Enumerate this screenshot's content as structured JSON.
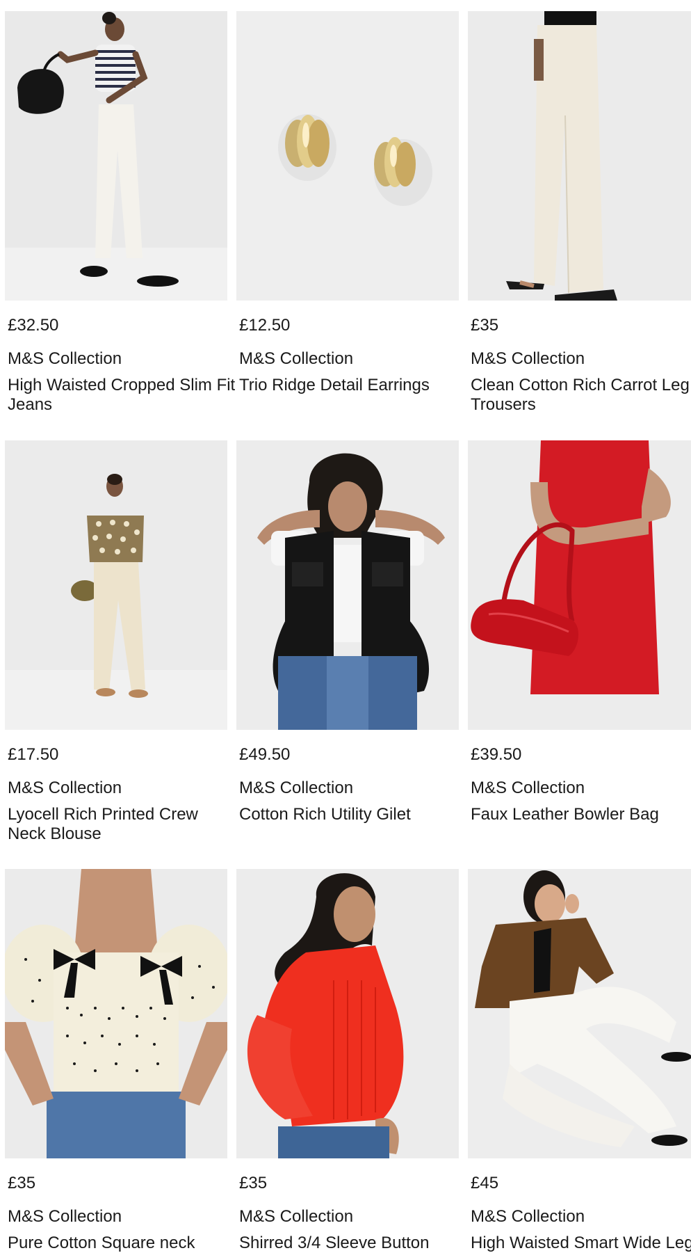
{
  "products": [
    {
      "price": "£32.50",
      "brand": "M&S Collection",
      "title": "High Waisted Cropped Slim Fit Jeans",
      "image": "model-white-cropped-jeans-striped-tee"
    },
    {
      "price": "£12.50",
      "brand": "M&S Collection",
      "title": "Trio Ridge Detail Earrings",
      "image": "gold-ridge-earrings"
    },
    {
      "price": "£35",
      "brand": "M&S Collection",
      "title": "Clean Cotton Rich Carrot Leg Trousers",
      "image": "model-cream-carrot-leg-trousers"
    },
    {
      "price": "£17.50",
      "brand": "M&S Collection",
      "title": "Lyocell Rich Printed Crew Neck Blouse",
      "image": "model-khaki-printed-blouse"
    },
    {
      "price": "£49.50",
      "brand": "M&S Collection",
      "title": "Cotton Rich Utility Gilet",
      "image": "model-black-utility-gilet"
    },
    {
      "price": "£39.50",
      "brand": "M&S Collection",
      "title": "Faux Leather Bowler Bag",
      "image": "model-red-bowler-bag"
    },
    {
      "price": "£35",
      "brand": "M&S Collection",
      "title": "Pure Cotton Square neck",
      "image": "model-polka-dot-bow-top"
    },
    {
      "price": "£35",
      "brand": "M&S Collection",
      "title": "Shirred 3/4 Sleeve Button",
      "image": "model-red-shirred-blouse"
    },
    {
      "price": "£45",
      "brand": "M&S Collection",
      "title": "High Waisted Smart Wide Leg",
      "image": "model-white-wide-leg-trousers"
    }
  ]
}
